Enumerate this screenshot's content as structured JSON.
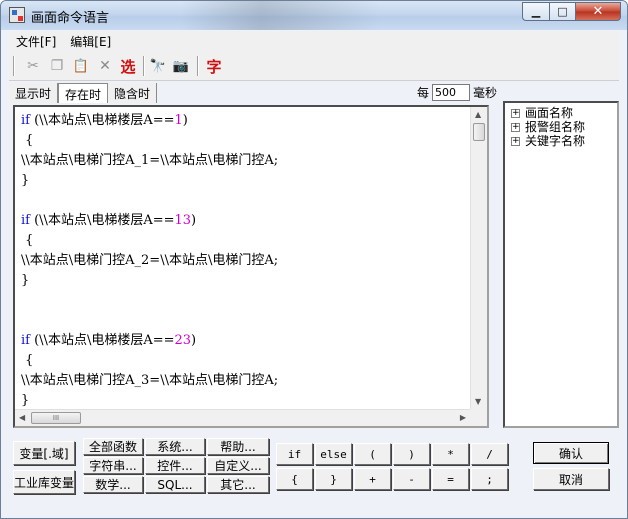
{
  "window": {
    "title": "画面命令语言",
    "controls": {
      "minimize": "▁",
      "maximize": "□",
      "close": "✕"
    }
  },
  "menu": [
    "文件[F]",
    "编辑[E]"
  ],
  "toolbar": {
    "icons": [
      "scissors-icon",
      "copy-icon",
      "paste-icon",
      "delete-icon",
      "binoculars-icon",
      "camera-icon"
    ],
    "select_label": "选",
    "font_label": "字",
    "glyphs": {
      "cut": "✂",
      "copy": "❐",
      "paste": "📋",
      "delete": "✕",
      "find": "🔭",
      "camera": "📷"
    }
  },
  "tabs": [
    "显示时",
    "存在时",
    "隐含时"
  ],
  "active_tab": "存在时",
  "interval": {
    "prefix": "每",
    "value": "500",
    "unit": "毫秒"
  },
  "code_lines": [
    [
      "if ",
      "(\\\\本站点\\电梯楼层A==",
      "1",
      ")"
    ],
    [
      "",
      " {",
      "",
      ""
    ],
    [
      "",
      "\\\\本站点\\电梯门控A_1=\\\\本站点\\电梯门控A;",
      "",
      ""
    ],
    [
      "",
      "}",
      "",
      ""
    ],
    [
      "",
      "",
      "",
      ""
    ],
    [
      "if ",
      "(\\\\本站点\\电梯楼层A==",
      "13",
      ")"
    ],
    [
      "",
      " {",
      "",
      ""
    ],
    [
      "",
      "\\\\本站点\\电梯门控A_2=\\\\本站点\\电梯门控A;",
      "",
      ""
    ],
    [
      "",
      "}",
      "",
      ""
    ],
    [
      "",
      "",
      "",
      ""
    ],
    [
      "",
      "",
      "",
      ""
    ],
    [
      "if ",
      "(\\\\本站点\\电梯楼层A==",
      "23",
      ")"
    ],
    [
      "",
      " {",
      "",
      ""
    ],
    [
      "",
      "\\\\本站点\\电梯门控A_3=\\\\本站点\\电梯门控A;",
      "",
      ""
    ],
    [
      "",
      "}",
      "",
      ""
    ]
  ],
  "tree": [
    "画面名称",
    "报警组名称",
    "关键字名称"
  ],
  "tree_expander": "+",
  "scroll_glyphs": {
    "up": "▲",
    "down": "▼",
    "left": "◀",
    "right": "▶",
    "grip": "III"
  },
  "buttons": {
    "variable": "变量[.域]",
    "industry_variable": "工业库变量",
    "func_grid": [
      "全部函数",
      "系统...",
      "帮助...",
      "字符串...",
      "控件...",
      "自定义...",
      "数学...",
      "SQL...",
      "其它..."
    ],
    "operators": [
      "if",
      "else",
      "(",
      ")",
      "*",
      "/",
      "{",
      "}",
      "+",
      "-",
      "=",
      ";"
    ],
    "confirm": "确认",
    "cancel": "取消"
  }
}
